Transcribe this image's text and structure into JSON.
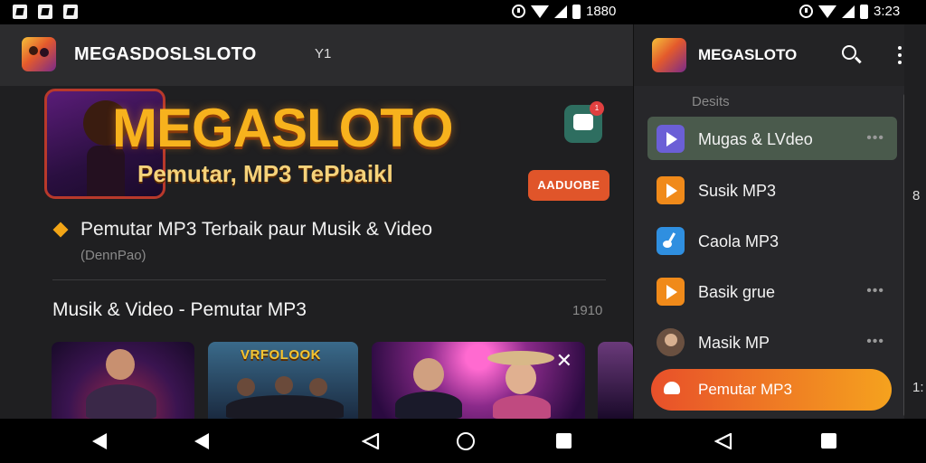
{
  "status_bar": {
    "left_time": "1880",
    "right_time": "3:23"
  },
  "app": {
    "title": "MEGASDOSLSLOTO",
    "header_action": "Y1"
  },
  "banner": {
    "brand": "MEGASLOTO",
    "subtitle": "Pemutar, MP3 TePbaikl",
    "button_label": "AADUOBE",
    "badge_count": "1"
  },
  "tagline": {
    "text": "Pemutar MP3 Terbaik paur Musik & Video",
    "sub": "(DennPao)"
  },
  "section": {
    "title": "Musik & Video - Pemutar MP3",
    "count": "1910"
  },
  "thumbnails": [
    {
      "title": ""
    },
    {
      "title": "VRFOLOOK"
    },
    {
      "title": ""
    },
    {
      "title": ""
    }
  ],
  "drawer": {
    "title": "MEGASLOTO",
    "section_label": "Desits",
    "items": [
      {
        "label": "Mugas & LVdeo",
        "icon": "play-icon",
        "color": "#6b5fd6",
        "active": true,
        "dots": true
      },
      {
        "label": "Susik MP3",
        "icon": "play-icon",
        "color": "#f08a1a",
        "active": false,
        "dots": false
      },
      {
        "label": "Caola MP3",
        "icon": "music-icon",
        "color": "#2f8fe0",
        "active": false,
        "dots": false
      },
      {
        "label": "Basik grue",
        "icon": "play-icon",
        "color": "#f08a1a",
        "active": false,
        "dots": true
      },
      {
        "label": "Masik MP",
        "icon": "avatar-icon",
        "color": "#6a5040",
        "active": false,
        "dots": true
      }
    ],
    "cta_label": "Pemutar MP3",
    "dots_glyph": "•••"
  },
  "edge": {
    "top": "8",
    "bottom": "1:"
  }
}
